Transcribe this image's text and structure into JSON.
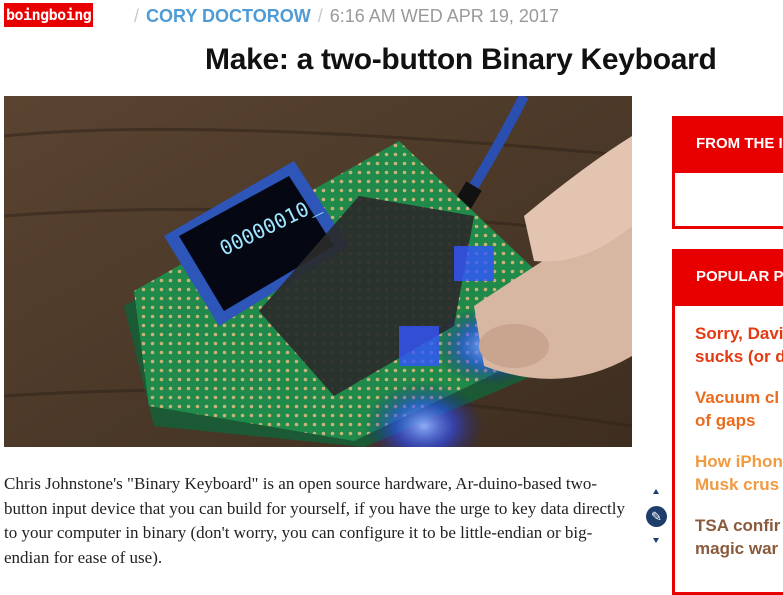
{
  "header": {
    "logo": "boingboing",
    "author": "CORY DOCTOROW",
    "separator": "/",
    "datetime": "6:16 AM WED APR 19, 2017"
  },
  "article": {
    "title": "Make: a two-button Binary Keyboard",
    "image": {
      "screen_text": "00000010_"
    },
    "paragraph": "Chris Johnstone's \"Binary Keyboard\" is an open source hardware, Ar-duino-based two-button input device that you can build for yourself, if you have the urge to key data directly to your computer in binary (don't worry, you can configure it to be little-endian or big-endian for ease of use)."
  },
  "sidebar": {
    "from_widget": {
      "title": "FROM THE I"
    },
    "popular_widget": {
      "title": "POPULAR P",
      "items": [
        {
          "line1": "Sorry, Davi",
          "line2": "sucks (or d",
          "color": "#e43a12"
        },
        {
          "line1": "Vacuum cl",
          "line2": "of gaps",
          "color": "#ea6b1c"
        },
        {
          "line1": "How iPhon",
          "line2": "Musk crus",
          "color": "#f09a42"
        },
        {
          "line1": "TSA confir",
          "line2": "magic war",
          "color": "#8a5a3c"
        }
      ]
    }
  },
  "colors": {
    "brand_red": "#e80000",
    "author_blue": "#4f9bd6",
    "scroll_button": "#1d3e6a"
  },
  "icons": {
    "scroll_up": "triangle-up",
    "scroll_down": "triangle-down",
    "edit": "pen"
  }
}
